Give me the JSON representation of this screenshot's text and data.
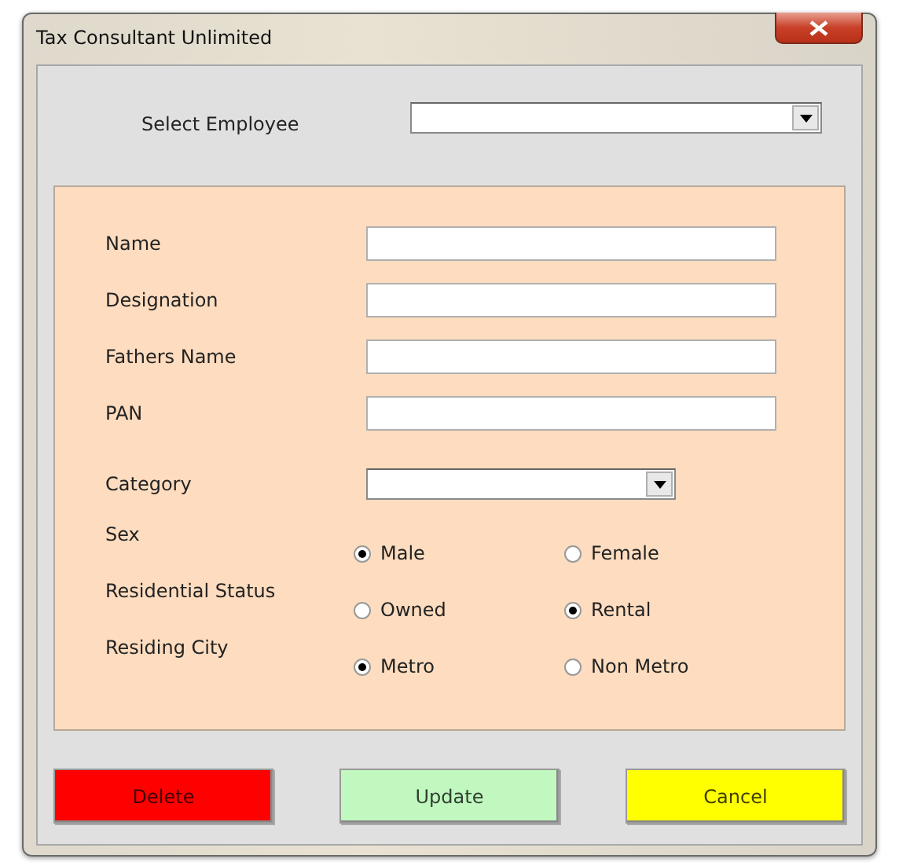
{
  "window": {
    "title": "Tax Consultant Unlimited"
  },
  "select_employee": {
    "label": "Select Employee"
  },
  "fields": [
    {
      "kind": "text",
      "label": "Name"
    },
    {
      "kind": "text",
      "label": "Designation"
    },
    {
      "kind": "text",
      "label": "Fathers Name"
    },
    {
      "kind": "text",
      "label": "PAN"
    },
    {
      "kind": "dropdown",
      "label": "Category"
    },
    {
      "kind": "radio",
      "label": "Sex",
      "options": [
        {
          "label": "Male",
          "selected": true
        },
        {
          "label": "Female",
          "selected": false
        }
      ]
    },
    {
      "kind": "radio",
      "label": "Residential Status",
      "options": [
        {
          "label": "Owned",
          "selected": false
        },
        {
          "label": "Rental",
          "selected": true
        }
      ]
    },
    {
      "kind": "radio",
      "label": "Residing City",
      "options": [
        {
          "label": "Metro",
          "selected": true
        },
        {
          "label": "Non Metro",
          "selected": false
        }
      ]
    }
  ],
  "buttons": [
    {
      "label": "Delete",
      "color": "#ff0000"
    },
    {
      "label": "Update",
      "color": "#c0f8c0"
    },
    {
      "label": "Cancel",
      "color": "#ffff00"
    }
  ]
}
